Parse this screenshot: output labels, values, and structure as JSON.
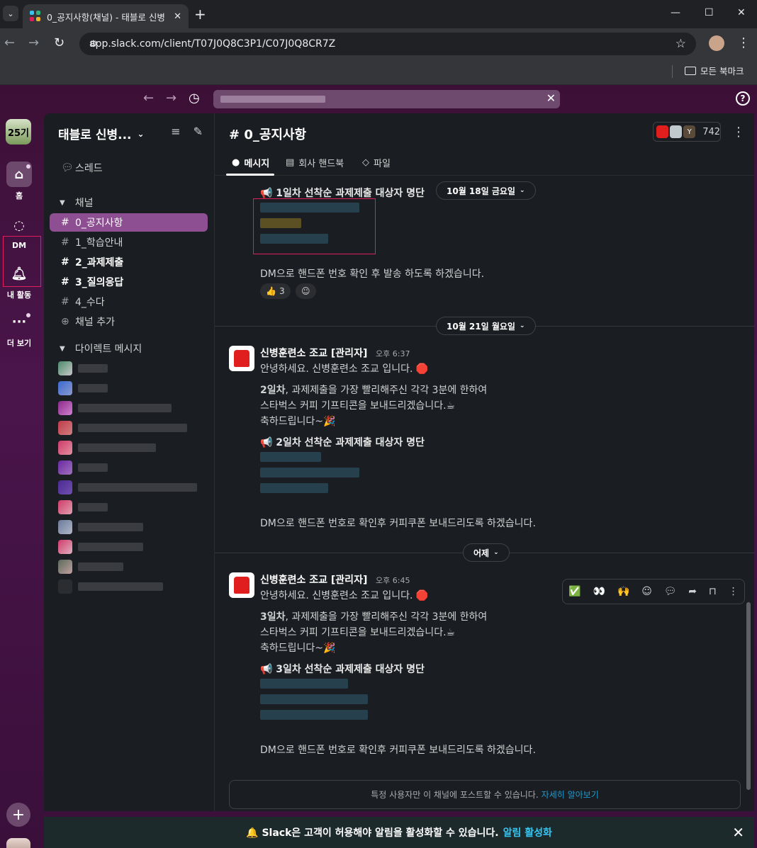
{
  "browser": {
    "tab_title": "0_공지사항(채널) - 태블로 신병",
    "url": "app.slack.com/client/T07J0Q8C3P1/C07J0Q8CR7Z",
    "bookmarks_label": "모든 북마크"
  },
  "rail": {
    "workspace_badge": "25기",
    "items": [
      {
        "label": "홈",
        "icon": "home-icon"
      },
      {
        "label": "DM",
        "icon": "dm-icon"
      },
      {
        "label": "내 활동",
        "icon": "bell-icon"
      },
      {
        "label": "더 보기",
        "icon": "more-icon"
      }
    ],
    "add_label": "+"
  },
  "sidebar": {
    "workspace_name": "태블로 신병...",
    "threads_label": "스레드",
    "channels_header": "채널",
    "channels": [
      {
        "name": "0_공지사항"
      },
      {
        "name": "1_학습안내"
      },
      {
        "name": "2_과제제출"
      },
      {
        "name": "3_질의응답"
      },
      {
        "name": "4_수다"
      }
    ],
    "add_channel_label": "채널 추가",
    "dm_header": "다이렉트 메시지"
  },
  "channel": {
    "title": "# 0_공지사항",
    "member_count": "742",
    "member_initial": "Y",
    "tabs": [
      "메시지",
      "회사 핸드북",
      "파일"
    ]
  },
  "messages": {
    "block1_heading": "📢 1일차 선착순 과제제출 대상자 명단",
    "block1_footer": "DM으로 핸드폰 번호 확인 후 발송 하도록 하겠습니다.",
    "reaction_count": "3",
    "date1": "10월 18일 금요일",
    "date2": "10월 21일 월요일",
    "date3": "어제",
    "msg2": {
      "sender": "신병훈련소 조교 [관리자]",
      "time": "오후 6:37",
      "greeting": "안녕하세요. 신병훈련소 조교 입니다. 🛑",
      "line1_bold": "2일차",
      "line1_rest": ", 과제제출을 가장 빨리해주신 각각 3분에 한하여",
      "line2": "스타벅스 커피 기프티콘을 보내드리겠습니다.☕",
      "line3": "축하드립니다~🎉",
      "heading": "📢 2일차  선착순 과제제출 대상자 명단",
      "footer": "DM으로 핸드폰 번호로 확인후 커피쿠폰 보내드리도록 하겠습니다."
    },
    "msg3": {
      "sender": "신병훈련소 조교 [관리자]",
      "time": "오후 6:45",
      "greeting": "안녕하세요. 신병훈련소 조교 입니다. 🛑",
      "line1_bold": "3일차",
      "line1_rest": ", 과제제출을 가장 빨리해주신 각각 3분에 한하여",
      "line2": "스타벅스 커피 기프티콘을 보내드리겠습니다.☕",
      "line3": "축하드립니다~🎉",
      "heading": "📢 3일차  선착순 과제제출 대상자 명단",
      "footer": "DM으로 핸드폰 번호로 확인후 커피쿠폰 보내드리도록 하겠습니다."
    }
  },
  "hover_actions": [
    "✅",
    "👀",
    "🙌"
  ],
  "composer": {
    "notice": "특정 사용자만 이 채널에 포스트할 수 있습니다.",
    "link": "자세히 알아보기"
  },
  "banner": {
    "text": "🔔 Slack은 고객이 허용해야 알림을 활성화할 수 있습니다.",
    "link": "알림 활성화"
  }
}
